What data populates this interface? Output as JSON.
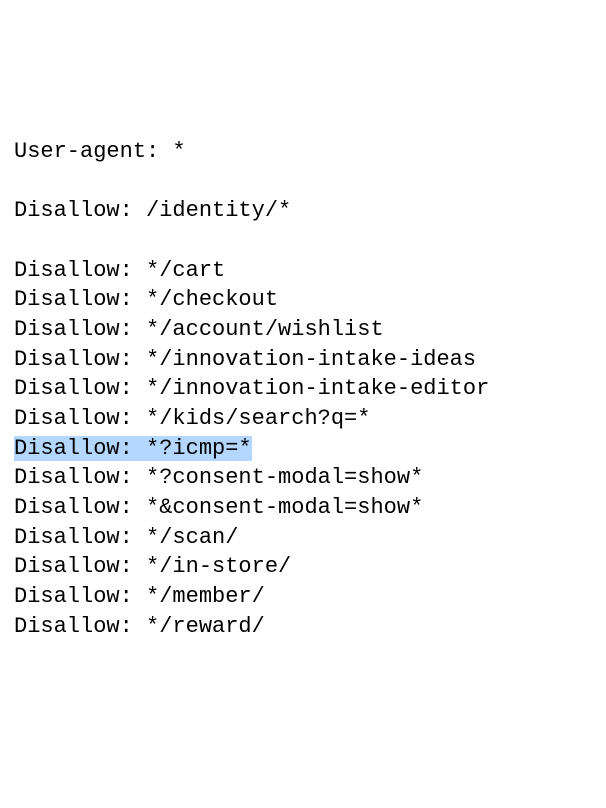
{
  "lines": [
    {
      "text": "User-agent: *",
      "highlighted": false
    },
    {
      "text": "",
      "highlighted": false
    },
    {
      "text": "Disallow: /identity/*",
      "highlighted": false
    },
    {
      "text": "",
      "highlighted": false
    },
    {
      "text": "Disallow: */cart",
      "highlighted": false
    },
    {
      "text": "Disallow: */checkout",
      "highlighted": false
    },
    {
      "text": "Disallow: */account/wishlist",
      "highlighted": false
    },
    {
      "text": "Disallow: */innovation-intake-ideas",
      "highlighted": false
    },
    {
      "text": "Disallow: */innovation-intake-editor",
      "highlighted": false
    },
    {
      "text": "Disallow: */kids/search?q=*",
      "highlighted": false
    },
    {
      "text": "Disallow: *?icmp=*",
      "highlighted": true
    },
    {
      "text": "Disallow: *?consent-modal=show*",
      "highlighted": false
    },
    {
      "text": "Disallow: *&consent-modal=show*",
      "highlighted": false
    },
    {
      "text": "Disallow: */scan/",
      "highlighted": false
    },
    {
      "text": "Disallow: */in-store/",
      "highlighted": false
    },
    {
      "text": "Disallow: */member/",
      "highlighted": false
    },
    {
      "text": "Disallow: */reward/",
      "highlighted": false
    }
  ]
}
